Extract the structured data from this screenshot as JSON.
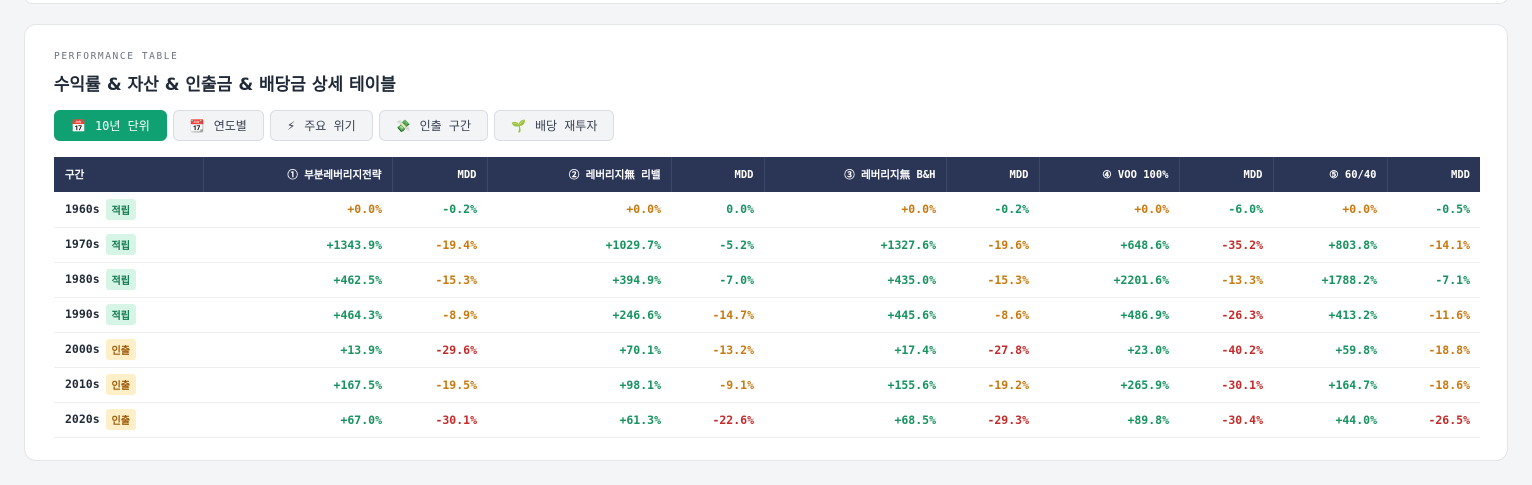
{
  "eyebrow": "PERFORMANCE TABLE",
  "title": "수익률 & 자산 & 인출금 & 배당금 상세 테이블",
  "tabs": [
    {
      "icon": "📅",
      "icon_name": "calendar-icon",
      "label": "10년 단위",
      "active": true
    },
    {
      "icon": "📆",
      "icon_name": "calendar-icon",
      "label": "연도별",
      "active": false
    },
    {
      "icon": "⚡",
      "icon_name": "lightning-icon",
      "label": "주요 위기",
      "active": false
    },
    {
      "icon": "💸",
      "icon_name": "money-wings-icon",
      "label": "인출 구간",
      "active": false
    },
    {
      "icon": "🌱",
      "icon_name": "seedling-icon",
      "label": "배당 재투자",
      "active": false
    }
  ],
  "colors": {
    "header_bg": "#2b3555",
    "active_tab": "#10a173",
    "positive": "#16935f",
    "neutral": "#c8790f",
    "negative": "#c52a2a",
    "badge_accum_bg": "#d6f5e6",
    "badge_accum_fg": "#137a4f",
    "badge_withdraw_bg": "#fdf0c8",
    "badge_withdraw_fg": "#a15c0a"
  },
  "table": {
    "headers": [
      "구간",
      "① 부분레버리지전략",
      "MDD",
      "② 레버리지無 리밸",
      "MDD",
      "③ 레버리지無 B&H",
      "MDD",
      "④ VOO 100%",
      "MDD",
      "⑤ 60/40",
      "MDD"
    ],
    "rows": [
      {
        "period": "1960s",
        "badge": "적립",
        "badge_type": "accum",
        "cells": [
          [
            "+0.0%",
            "neu"
          ],
          [
            "-0.2%",
            "pos"
          ],
          [
            "+0.0%",
            "neu"
          ],
          [
            "0.0%",
            "pos"
          ],
          [
            "+0.0%",
            "neu"
          ],
          [
            "-0.2%",
            "pos"
          ],
          [
            "+0.0%",
            "neu"
          ],
          [
            "-6.0%",
            "pos"
          ],
          [
            "+0.0%",
            "neu"
          ],
          [
            "-0.5%",
            "pos"
          ]
        ]
      },
      {
        "period": "1970s",
        "badge": "적립",
        "badge_type": "accum",
        "cells": [
          [
            "+1343.9%",
            "pos"
          ],
          [
            "-19.4%",
            "neu"
          ],
          [
            "+1029.7%",
            "pos"
          ],
          [
            "-5.2%",
            "pos"
          ],
          [
            "+1327.6%",
            "pos"
          ],
          [
            "-19.6%",
            "neu"
          ],
          [
            "+648.6%",
            "pos"
          ],
          [
            "-35.2%",
            "neg"
          ],
          [
            "+803.8%",
            "pos"
          ],
          [
            "-14.1%",
            "neu"
          ]
        ]
      },
      {
        "period": "1980s",
        "badge": "적립",
        "badge_type": "accum",
        "cells": [
          [
            "+462.5%",
            "pos"
          ],
          [
            "-15.3%",
            "neu"
          ],
          [
            "+394.9%",
            "pos"
          ],
          [
            "-7.0%",
            "pos"
          ],
          [
            "+435.0%",
            "pos"
          ],
          [
            "-15.3%",
            "neu"
          ],
          [
            "+2201.6%",
            "pos"
          ],
          [
            "-13.3%",
            "neu"
          ],
          [
            "+1788.2%",
            "pos"
          ],
          [
            "-7.1%",
            "pos"
          ]
        ]
      },
      {
        "period": "1990s",
        "badge": "적립",
        "badge_type": "accum",
        "cells": [
          [
            "+464.3%",
            "pos"
          ],
          [
            "-8.9%",
            "neu"
          ],
          [
            "+246.6%",
            "pos"
          ],
          [
            "-14.7%",
            "neu"
          ],
          [
            "+445.6%",
            "pos"
          ],
          [
            "-8.6%",
            "neu"
          ],
          [
            "+486.9%",
            "pos"
          ],
          [
            "-26.3%",
            "neg"
          ],
          [
            "+413.2%",
            "pos"
          ],
          [
            "-11.6%",
            "neu"
          ]
        ]
      },
      {
        "period": "2000s",
        "badge": "인출",
        "badge_type": "withdraw",
        "cells": [
          [
            "+13.9%",
            "pos"
          ],
          [
            "-29.6%",
            "neg"
          ],
          [
            "+70.1%",
            "pos"
          ],
          [
            "-13.2%",
            "neu"
          ],
          [
            "+17.4%",
            "pos"
          ],
          [
            "-27.8%",
            "neg"
          ],
          [
            "+23.0%",
            "pos"
          ],
          [
            "-40.2%",
            "neg"
          ],
          [
            "+59.8%",
            "pos"
          ],
          [
            "-18.8%",
            "neu"
          ]
        ]
      },
      {
        "period": "2010s",
        "badge": "인출",
        "badge_type": "withdraw",
        "cells": [
          [
            "+167.5%",
            "pos"
          ],
          [
            "-19.5%",
            "neu"
          ],
          [
            "+98.1%",
            "pos"
          ],
          [
            "-9.1%",
            "neu"
          ],
          [
            "+155.6%",
            "pos"
          ],
          [
            "-19.2%",
            "neu"
          ],
          [
            "+265.9%",
            "pos"
          ],
          [
            "-30.1%",
            "neg"
          ],
          [
            "+164.7%",
            "pos"
          ],
          [
            "-18.6%",
            "neu"
          ]
        ]
      },
      {
        "period": "2020s",
        "badge": "인출",
        "badge_type": "withdraw",
        "cells": [
          [
            "+67.0%",
            "pos"
          ],
          [
            "-30.1%",
            "neg"
          ],
          [
            "+61.3%",
            "pos"
          ],
          [
            "-22.6%",
            "neg"
          ],
          [
            "+68.5%",
            "pos"
          ],
          [
            "-29.3%",
            "neg"
          ],
          [
            "+89.8%",
            "pos"
          ],
          [
            "-30.4%",
            "neg"
          ],
          [
            "+44.0%",
            "pos"
          ],
          [
            "-26.5%",
            "neg"
          ]
        ]
      }
    ]
  }
}
